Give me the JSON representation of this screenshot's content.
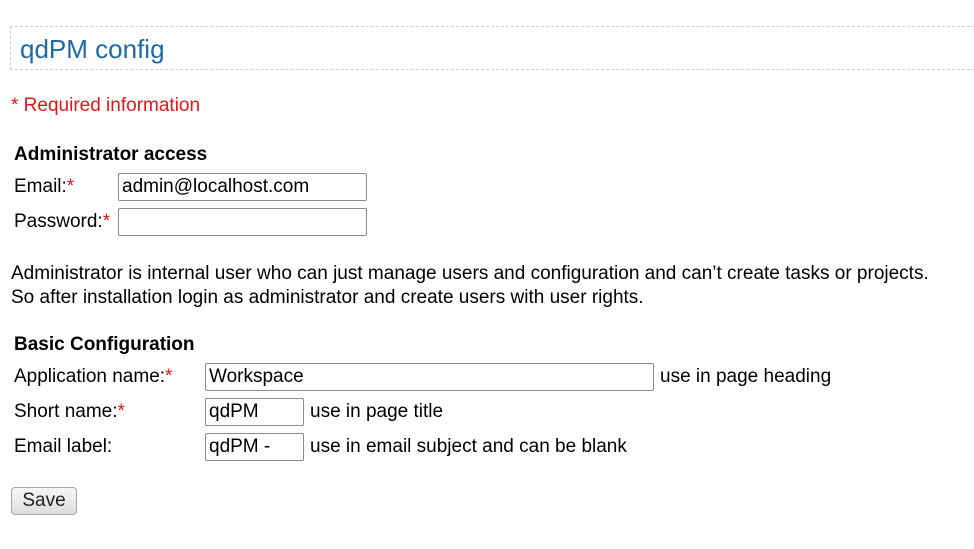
{
  "header": {
    "title": "qdPM config"
  },
  "required_note": "* Required information",
  "admin_section": {
    "title": "Administrator access",
    "email_label": "Email:",
    "email_value": "admin@localhost.com",
    "password_label": "Password:",
    "password_value": "",
    "required_marker": "*"
  },
  "description": {
    "line1": "Administrator is internal user who can just manage users and configuration and can’t create tasks or projects.",
    "line2": "So after installation login as administrator and create users with user rights."
  },
  "basic_section": {
    "title": "Basic Configuration",
    "app_name_label": "Application name:",
    "app_name_value": "Workspace",
    "app_name_hint": "use in page heading",
    "short_name_label": "Short name:",
    "short_name_value": "qdPM",
    "short_name_hint": "use in page title",
    "email_label_label": "Email label:",
    "email_label_value": "qdPM -",
    "email_label_hint": "use in email subject and can be blank",
    "required_marker": "*"
  },
  "save_button": {
    "label": "Save"
  },
  "colors": {
    "title_blue": "#1f6aa5",
    "required_red": "#e0191b"
  }
}
